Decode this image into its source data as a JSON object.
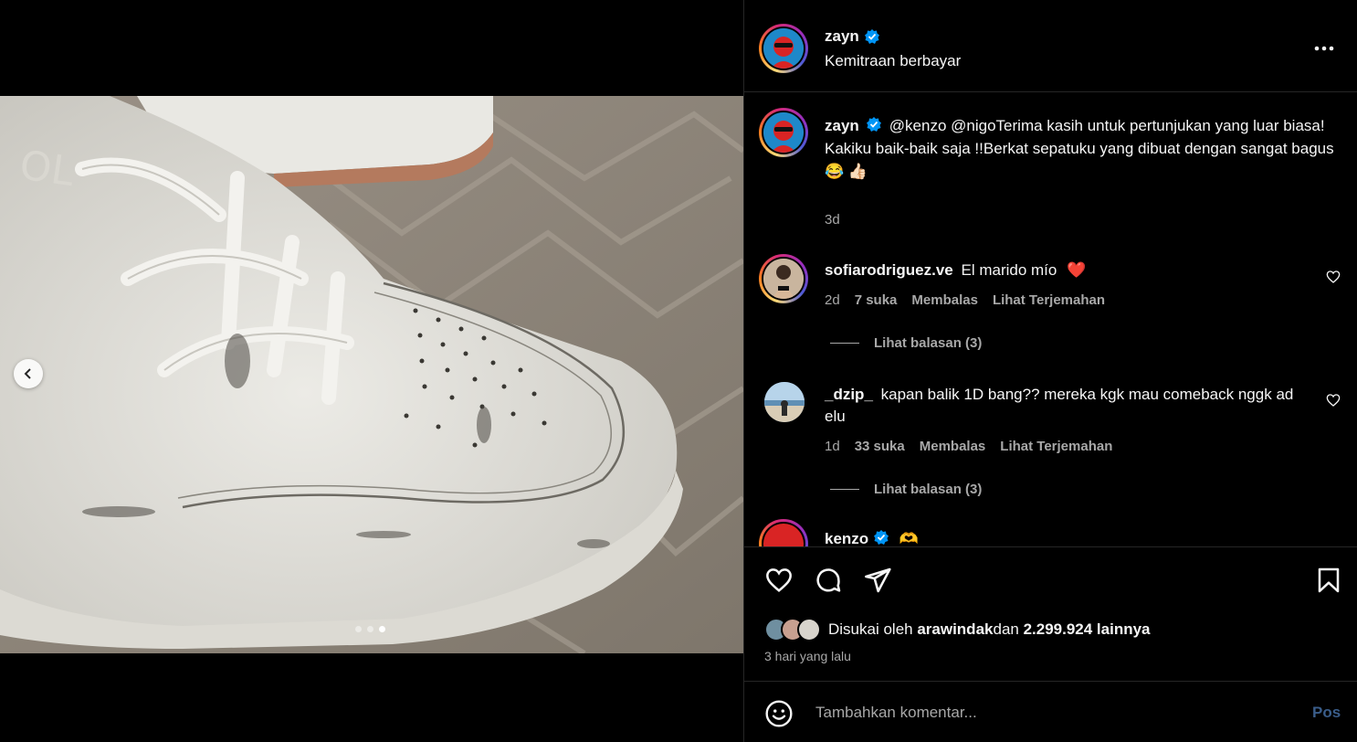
{
  "post": {
    "author": "zayn",
    "subtitle": "Kemitraan berbayar",
    "carousel": {
      "count": 3,
      "active_index": 2
    }
  },
  "caption": {
    "username": "zayn",
    "mentions": "@kenzo @nigo",
    "text": "Terima kasih untuk pertunjukan yang luar biasa! Kakiku baik-baik saja !!Berkat sepatuku yang dibuat dengan sangat bagus",
    "emojis": "😂 👍🏻",
    "time": "3d"
  },
  "comments": [
    {
      "username": "sofiarodriguez.ve",
      "text": "El marido mío",
      "emoji": "❤️",
      "time": "2d",
      "likes": "7 suka",
      "reply_label": "Membalas",
      "translate_label": "Lihat Terjemahan",
      "view_replies": "Lihat balasan (3)"
    },
    {
      "username": "_dzip_",
      "text": "kapan balik 1D bang?? mereka kgk mau comeback nggk ad elu",
      "time": "1d",
      "likes": "33 suka",
      "reply_label": "Membalas",
      "translate_label": "Lihat Terjemahan",
      "view_replies": "Lihat balasan (3)"
    },
    {
      "username": "kenzo",
      "emoji": "🫶"
    }
  ],
  "likes": {
    "prefix": "Disukai oleh ",
    "user": "arawindak",
    "middle": "dan ",
    "count": "2.299.924 lainnya"
  },
  "time_ago": "3 hari yang lalu",
  "add_comment": {
    "placeholder": "Tambahkan komentar...",
    "post_label": "Pos"
  },
  "colors": {
    "background": "#000000",
    "verified": "#0095f6",
    "muted": "#a8a8a8",
    "like_heart": "#ff3040"
  }
}
